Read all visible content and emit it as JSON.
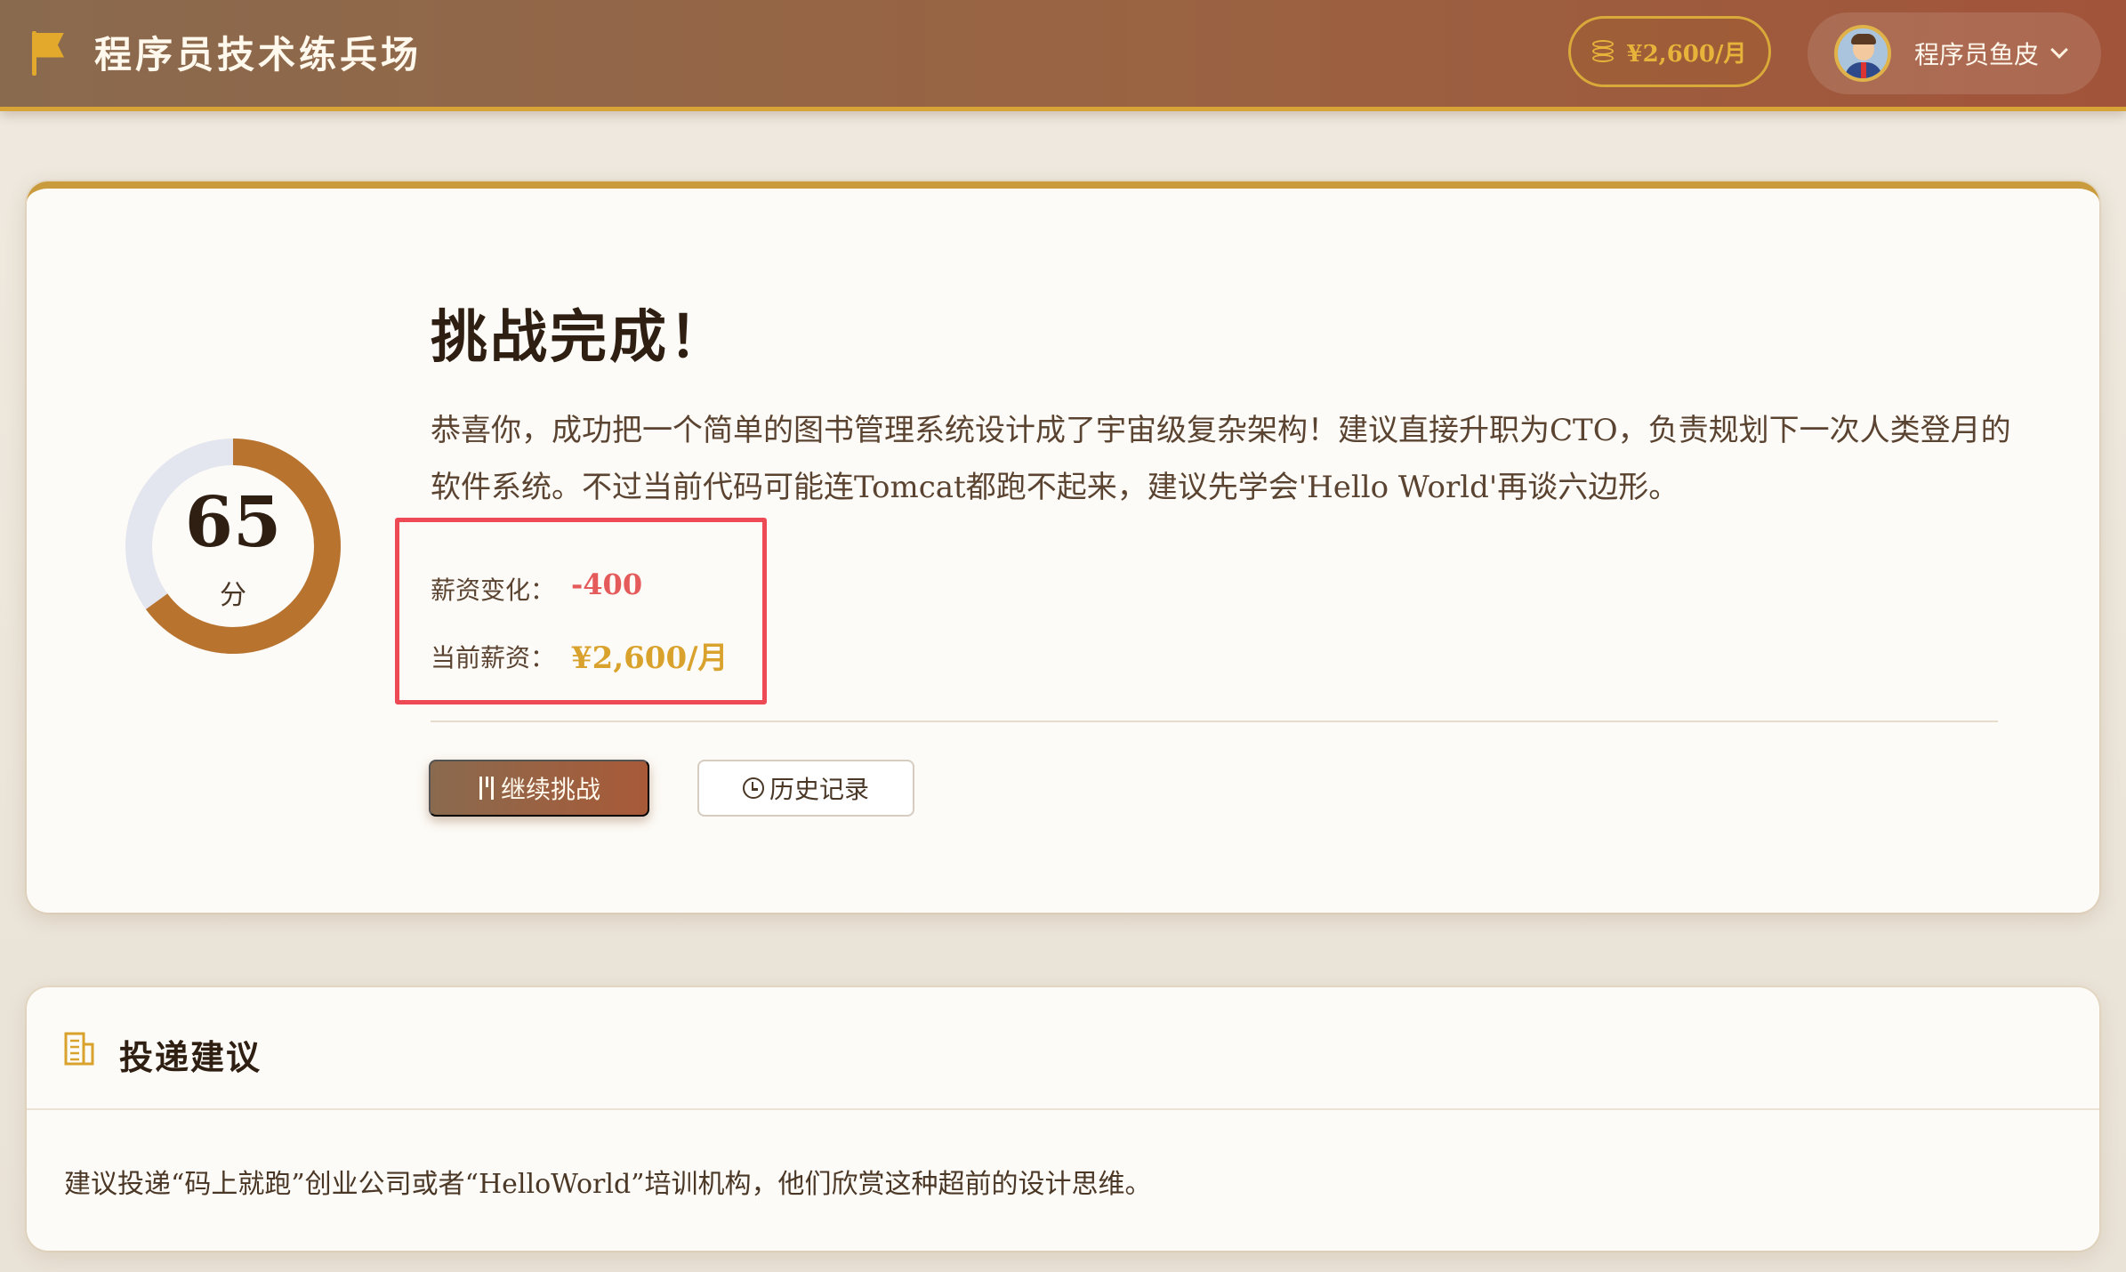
{
  "header": {
    "brand_title": "程序员技术练兵场",
    "salary_badge": "¥2,600/月",
    "user_name": "程序员鱼皮"
  },
  "result": {
    "score": 65,
    "score_max": 100,
    "score_unit": "分",
    "title": "挑战完成！",
    "description": "恭喜你，成功把一个简单的图书管理系统设计成了宇宙级复杂架构！建议直接升职为CTO，负责规划下一次人类登月的软件系统。不过当前代码可能连Tomcat都跑不起来，建议先学会'Hello World'再谈六边形。",
    "salary_change_label": "薪资变化：",
    "salary_change_value": "-400",
    "current_salary_label": "当前薪资：",
    "current_salary_value": "¥2,600/月",
    "continue_button": "继续挑战",
    "history_button": "历史记录"
  },
  "suggestion": {
    "title": "投递建议",
    "text": "建议投递“码上就跑”创业公司或者“HelloWorld”培训机构，他们欣赏这种超前的设计思维。"
  },
  "colors": {
    "accent_gold": "#d9a22c",
    "negative_red": "#e55a5a",
    "ring_progress": "#b8732f",
    "ring_track": "#e3e6ee",
    "highlight_border": "#ee4a55"
  },
  "icons": [
    "flag-icon",
    "coin-icon",
    "chevron-down-icon",
    "utensils-icon",
    "clock-icon",
    "building-icon"
  ]
}
